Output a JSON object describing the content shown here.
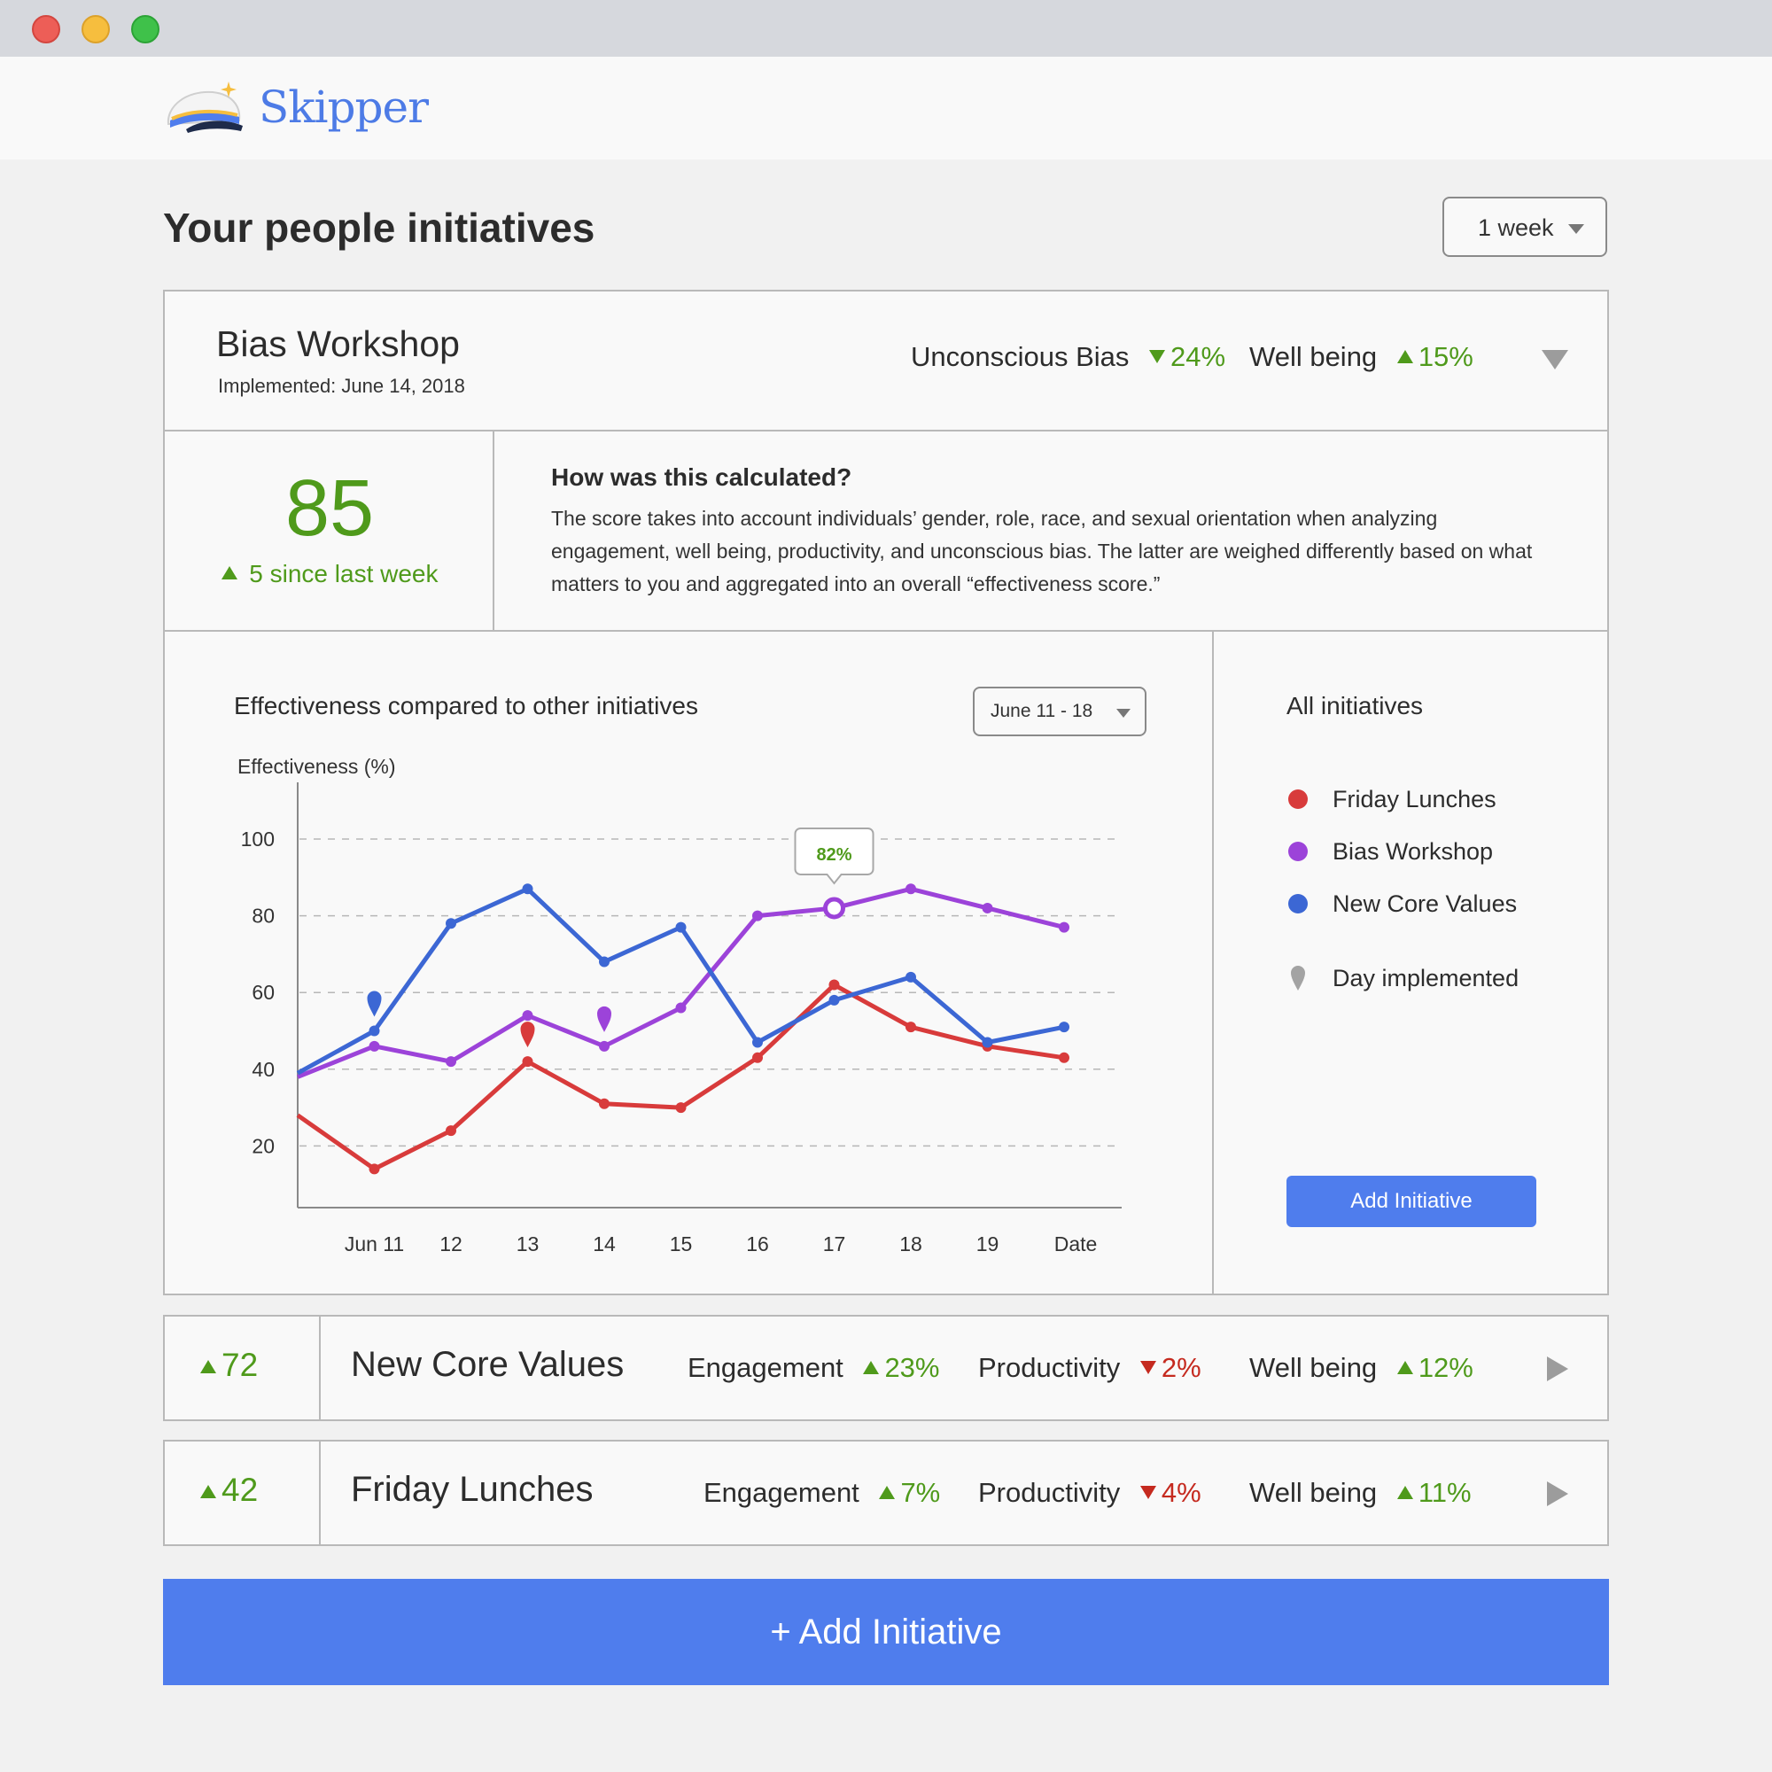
{
  "window": {
    "controls": [
      "close",
      "minimize",
      "maximize"
    ]
  },
  "app": {
    "name": "Skipper",
    "logo_icon": "captain-hat-icon"
  },
  "page": {
    "title": "Your people initiatives",
    "range_select": "1 week"
  },
  "expanded_initiative": {
    "name": "Bias Workshop",
    "implemented": "Implemented: June 14, 2018",
    "metrics": [
      {
        "label": "Unconscious Bias",
        "value": "24%",
        "direction": "down",
        "sentiment": "positive"
      },
      {
        "label": "Well being",
        "value": "15%",
        "direction": "up",
        "sentiment": "positive"
      }
    ],
    "score": "85",
    "score_delta": "5 since last week",
    "calc_title": "How was this calculated?",
    "calc_text": "The score takes into account individuals’ gender, role, race, and sexual orientation when analyzing engagement, well being, productivity, and unconscious bias. The latter are weighed differently based on what matters to you and aggregated into an overall “effectiveness score.”",
    "chart_title": "Effectiveness compared to other initiatives",
    "date_select": "June 11 - 18"
  },
  "chart_data": {
    "type": "line",
    "ylabel": "Effectiveness (%)",
    "xlabel": "Date",
    "ylim": [
      0,
      100
    ],
    "yticks": [
      20,
      40,
      60,
      80,
      100
    ],
    "x_tick_labels": [
      "Jun 11",
      "12",
      "13",
      "14",
      "15",
      "16",
      "17",
      "18",
      "19"
    ],
    "x": [
      10,
      11,
      12,
      13,
      14,
      15,
      16,
      17,
      18,
      19,
      20
    ],
    "grid": true,
    "series": [
      {
        "name": "Friday Lunches",
        "color": "#d83b3b",
        "values": [
          28,
          14,
          24,
          42,
          31,
          30,
          43,
          62,
          51,
          46,
          43
        ],
        "implemented_x": 13
      },
      {
        "name": "Bias Workshop",
        "color": "#9c43d9",
        "values": [
          38,
          46,
          42,
          54,
          46,
          56,
          80,
          82,
          87,
          82,
          77
        ],
        "implemented_x": 14
      },
      {
        "name": "New Core Values",
        "color": "#3c67d4",
        "values": [
          39,
          50,
          78,
          87,
          68,
          77,
          47,
          58,
          64,
          47,
          51
        ],
        "implemented_x": 11
      }
    ],
    "highlight": {
      "series": "Bias Workshop",
      "x": 17,
      "label": "82%"
    }
  },
  "legend": {
    "title": "All initiatives",
    "items": [
      {
        "label": "Friday Lunches",
        "color": "#d83b3b"
      },
      {
        "label": "Bias Workshop",
        "color": "#9c43d9"
      },
      {
        "label": "New Core Values",
        "color": "#3c67d4"
      }
    ],
    "implemented_label": "Day implemented",
    "implemented_icon": "map-pin-icon",
    "add_button": "Add Initiative"
  },
  "initiatives": [
    {
      "score": "72",
      "name": "New Core Values",
      "metrics": [
        {
          "label": "Engagement",
          "value": "23%",
          "direction": "up"
        },
        {
          "label": "Productivity",
          "value": "2%",
          "direction": "down"
        },
        {
          "label": "Well being",
          "value": "12%",
          "direction": "up"
        }
      ]
    },
    {
      "score": "42",
      "name": "Friday Lunches",
      "metrics": [
        {
          "label": "Engagement",
          "value": "7%",
          "direction": "up"
        },
        {
          "label": "Productivity",
          "value": "4%",
          "direction": "down"
        },
        {
          "label": "Well being",
          "value": "11%",
          "direction": "up"
        }
      ]
    }
  ],
  "add_button": "+ Add Initiative"
}
